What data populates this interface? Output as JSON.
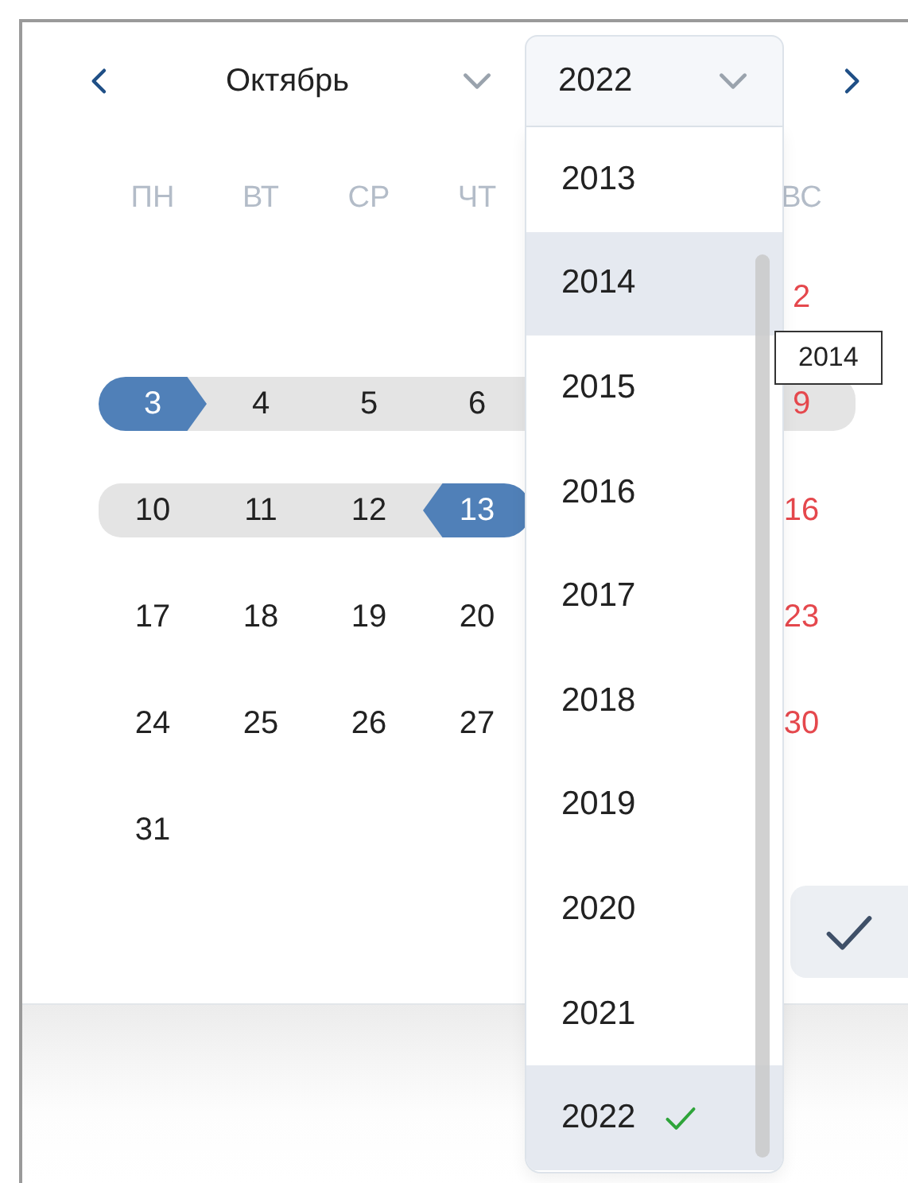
{
  "header": {
    "month": "Октябрь",
    "year": "2022"
  },
  "weekdays": [
    {
      "kind": "label",
      "text": "ПН"
    },
    {
      "kind": "label",
      "text": "ВТ"
    },
    {
      "kind": "label",
      "text": "СР"
    },
    {
      "kind": "label",
      "text": "ЧТ"
    },
    {
      "kind": "blank"
    },
    {
      "kind": "blank"
    },
    {
      "kind": "label",
      "text": "ВС"
    }
  ],
  "weeks": [
    {
      "days": [
        {
          "kind": "blank"
        },
        {
          "kind": "blank"
        },
        {
          "kind": "blank"
        },
        {
          "kind": "blank"
        },
        {
          "kind": "blank"
        },
        {
          "kind": "blank"
        },
        {
          "kind": "day",
          "day": "2",
          "in_range": false,
          "range_start": false,
          "range_end": false
        }
      ]
    },
    {
      "days": [
        {
          "kind": "day",
          "day": "3",
          "in_range": true,
          "range_start": true,
          "range_end": false
        },
        {
          "kind": "day",
          "day": "4",
          "in_range": true,
          "range_start": false,
          "range_end": false
        },
        {
          "kind": "day",
          "day": "5",
          "in_range": true,
          "range_start": false,
          "range_end": false
        },
        {
          "kind": "day",
          "day": "6",
          "in_range": true,
          "range_start": false,
          "range_end": false
        },
        {
          "kind": "blank"
        },
        {
          "kind": "blank"
        },
        {
          "kind": "day",
          "day": "9",
          "in_range": true,
          "range_start": false,
          "range_end": false
        }
      ]
    },
    {
      "days": [
        {
          "kind": "day",
          "day": "10",
          "in_range": true,
          "range_start": false,
          "range_end": false
        },
        {
          "kind": "day",
          "day": "11",
          "in_range": true,
          "range_start": false,
          "range_end": false
        },
        {
          "kind": "day",
          "day": "12",
          "in_range": true,
          "range_start": false,
          "range_end": false
        },
        {
          "kind": "day",
          "day": "13",
          "in_range": true,
          "range_start": false,
          "range_end": true
        },
        {
          "kind": "blank"
        },
        {
          "kind": "blank"
        },
        {
          "kind": "day",
          "day": "16",
          "in_range": false,
          "range_start": false,
          "range_end": false
        }
      ]
    },
    {
      "days": [
        {
          "kind": "day",
          "day": "17",
          "in_range": false,
          "range_start": false,
          "range_end": false
        },
        {
          "kind": "day",
          "day": "18",
          "in_range": false,
          "range_start": false,
          "range_end": false
        },
        {
          "kind": "day",
          "day": "19",
          "in_range": false,
          "range_start": false,
          "range_end": false
        },
        {
          "kind": "day",
          "day": "20",
          "in_range": false,
          "range_start": false,
          "range_end": false
        },
        {
          "kind": "blank"
        },
        {
          "kind": "blank"
        },
        {
          "kind": "day",
          "day": "23",
          "in_range": false,
          "range_start": false,
          "range_end": false
        }
      ]
    },
    {
      "days": [
        {
          "kind": "day",
          "day": "24",
          "in_range": false,
          "range_start": false,
          "range_end": false
        },
        {
          "kind": "day",
          "day": "25",
          "in_range": false,
          "range_start": false,
          "range_end": false
        },
        {
          "kind": "day",
          "day": "26",
          "in_range": false,
          "range_start": false,
          "range_end": false
        },
        {
          "kind": "day",
          "day": "27",
          "in_range": false,
          "range_start": false,
          "range_end": false
        },
        {
          "kind": "blank"
        },
        {
          "kind": "blank"
        },
        {
          "kind": "day",
          "day": "30",
          "in_range": false,
          "range_start": false,
          "range_end": false
        }
      ]
    },
    {
      "days": [
        {
          "kind": "day",
          "day": "31",
          "in_range": false,
          "range_start": false,
          "range_end": false
        }
      ]
    }
  ],
  "year_dropdown": {
    "items": [
      {
        "label": "2013",
        "selected": false,
        "highlighted": false
      },
      {
        "label": "2014",
        "selected": false,
        "highlighted": true
      },
      {
        "label": "2015",
        "selected": false,
        "highlighted": false
      },
      {
        "label": "2016",
        "selected": false,
        "highlighted": false
      },
      {
        "label": "2017",
        "selected": false,
        "highlighted": false
      },
      {
        "label": "2018",
        "selected": false,
        "highlighted": false
      },
      {
        "label": "2019",
        "selected": false,
        "highlighted": false
      },
      {
        "label": "2020",
        "selected": false,
        "highlighted": false
      },
      {
        "label": "2021",
        "selected": false,
        "highlighted": false
      },
      {
        "label": "2022",
        "selected": true,
        "highlighted": false
      }
    ]
  },
  "tooltip": "2014"
}
